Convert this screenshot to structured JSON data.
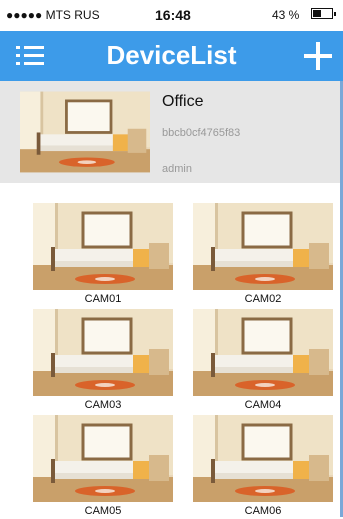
{
  "status_bar": {
    "carrier": "●●●●● MTS RUS",
    "time": "16:48",
    "battery_pct": "43 %",
    "battery_level": 0.43
  },
  "nav": {
    "title": "DeviceList",
    "menu_icon": "list-menu-icon",
    "add_icon": "plus-icon",
    "accent": "#3d9be9"
  },
  "device": {
    "name": "Office",
    "id": "bbcb0cf4765f83",
    "user": "admin"
  },
  "cameras": [
    {
      "label": "CAM01"
    },
    {
      "label": "CAM02"
    },
    {
      "label": "CAM03"
    },
    {
      "label": "CAM04"
    },
    {
      "label": "CAM05"
    },
    {
      "label": "CAM06"
    }
  ]
}
